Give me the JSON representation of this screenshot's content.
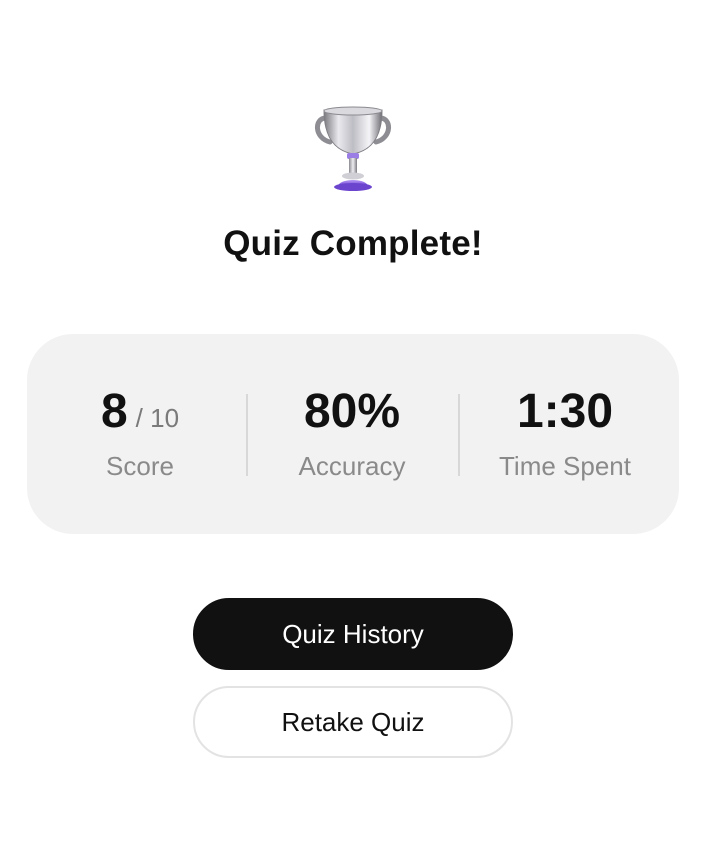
{
  "header": {
    "icon": "trophy-icon",
    "title": "Quiz Complete!"
  },
  "stats": {
    "score": {
      "value": "8",
      "suffix": "/ 10",
      "label": "Score"
    },
    "accuracy": {
      "value": "80%",
      "label": "Accuracy"
    },
    "time_spent": {
      "value": "1:30",
      "label": "Time Spent"
    }
  },
  "actions": {
    "history_label": "Quiz History",
    "retake_label": "Retake Quiz"
  },
  "colors": {
    "primary_button": "#111111",
    "card_background": "#f2f2f2",
    "muted_text": "#8a8a8a",
    "trophy_accent": "#8b5cf6"
  }
}
